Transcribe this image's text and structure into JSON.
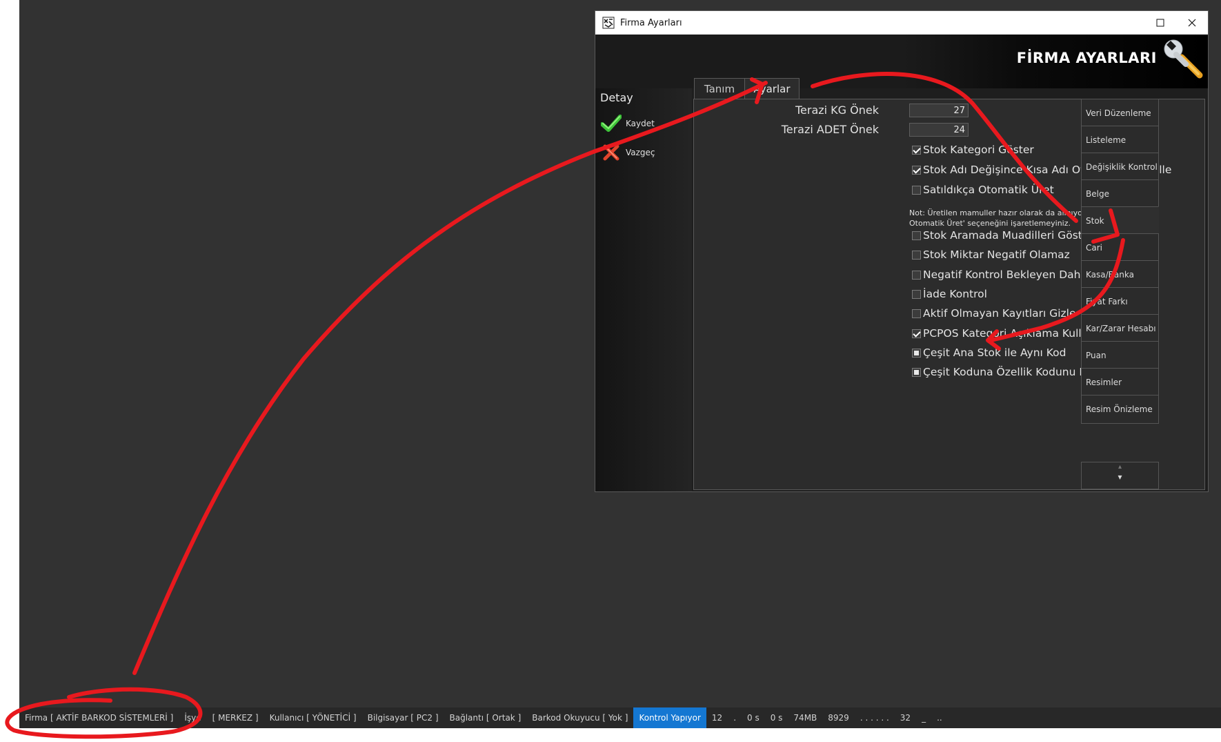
{
  "window": {
    "title": "Firma Ayarları",
    "banner_title": "FİRMA AYARLARI",
    "icons": {
      "app": "app-icon",
      "maximize": "maximize-icon",
      "close": "close-icon",
      "banner": "wrench-icon"
    }
  },
  "left_panel": {
    "heading": "Detay",
    "buttons": [
      {
        "label": "Kaydet",
        "icon": "checkmark-icon"
      },
      {
        "label": "Vazgeç",
        "icon": "cross-icon"
      }
    ]
  },
  "tabs": [
    {
      "label": "Tanım",
      "active": false
    },
    {
      "label": "Ayarlar",
      "active": true
    }
  ],
  "fields": [
    {
      "label": "Terazi KG Önek",
      "value": "27"
    },
    {
      "label": "Terazi ADET Önek",
      "value": "24"
    }
  ],
  "checkboxes": [
    {
      "label": "Stok Kategori Göster",
      "state": "checked"
    },
    {
      "label": "Stok Adı Değişince Kısa Adı Otomatik Güncelle",
      "state": "checked"
    },
    {
      "label": "Satıldıkça Otomatik Üret",
      "state": "unchecked"
    },
    {
      "label": "Stok Aramada Muadilleri Göster",
      "state": "unchecked"
    },
    {
      "label": "Stok Miktar Negatif Olamaz",
      "state": "unchecked"
    },
    {
      "label": "Negatif Kontrol Bekleyen Dahil",
      "state": "unchecked"
    },
    {
      "label": "İade Kontrol",
      "state": "unchecked"
    },
    {
      "label": "Aktif Olmayan Kayıtları Gizle",
      "state": "unchecked"
    },
    {
      "label": "PCPOS Kategori Açıklama Kullan",
      "state": "checked"
    },
    {
      "label": "Çeşit Ana Stok ile Aynı Kod",
      "state": "indeterminate"
    },
    {
      "label": "Çeşit Koduna Özellik Kodunu Ekle",
      "state": "indeterminate"
    }
  ],
  "note": "Not: Üretilen mamuller hazır olarak da alınıyorsa 'Satıldıkça Otomatik Üret' seçeneğini işaretlemeyiniz.",
  "nav": {
    "items": [
      "Veri Düzenleme",
      "Listeleme",
      "Değişiklik Kontrol",
      "Belge",
      "Stok",
      "Cari",
      "Kasa/Banka",
      "Fiyat Farkı",
      "Kar/Zarar Hesabı",
      "Puan",
      "Resimler",
      "Resim Önizleme"
    ],
    "active": "Stok",
    "scroll_up": "▴",
    "scroll_down": "▾"
  },
  "statusbar": {
    "segments": [
      "Firma [ AKTİF BARKOD SİSTEMLERİ ]",
      "İşye",
      "[ MERKEZ ]",
      "Kullanıcı [ YÖNETİCİ ]",
      "Bilgisayar [ PC2 ]",
      "Bağlantı [ Ortak ]",
      "Barkod Okuyucu [ Yok ]",
      "Kontrol Yapıyor",
      "12",
      ".",
      "0 s",
      "0 s",
      "74MB",
      "8929",
      ". . . . . .",
      "32",
      "_",
      ".."
    ],
    "highlighted": "Kontrol Yapıyor",
    "highlight_color": "#1477d2"
  },
  "colors": {
    "desktop": "#323232",
    "panel": "#2c2c2c",
    "annotation": "#e8191e"
  }
}
